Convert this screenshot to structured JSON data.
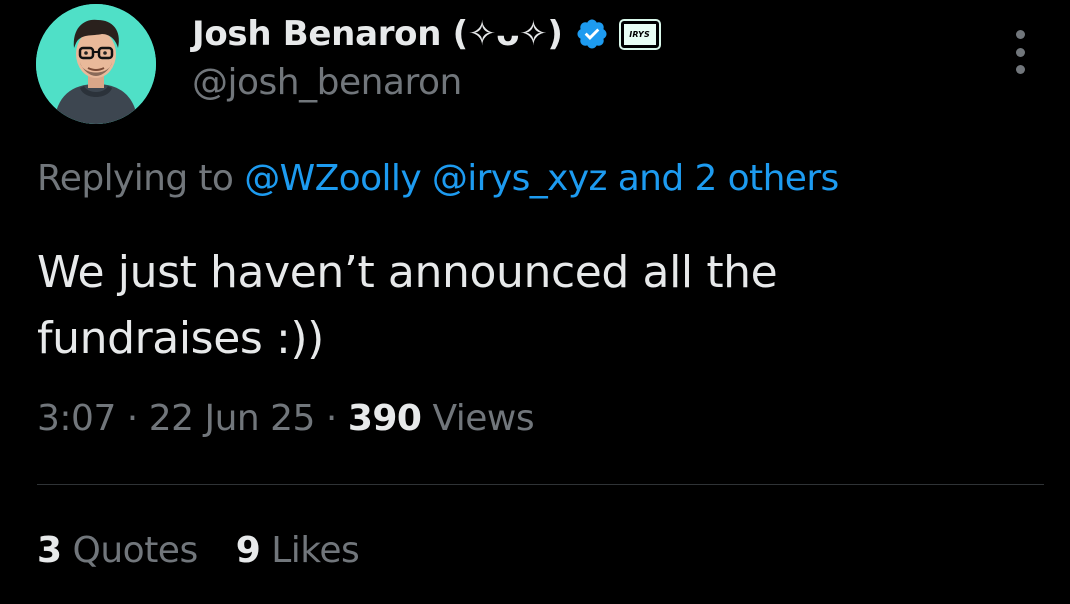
{
  "author": {
    "display_name": "Josh Benaron (✧ᴗ✧)",
    "handle": "@josh_benaron",
    "affiliate_badge_text": "IRYS",
    "verified_color": "#1d9bf0",
    "avatar_icon": "cartoon-avatar-with-glasses"
  },
  "reply": {
    "prefix": "Replying to ",
    "mention_1": "@WZoolly",
    "mention_2": "@irys_xyz",
    "others": "and 2 others"
  },
  "tweet": {
    "line_1": "We just haven’t announced all the",
    "line_2": "fundraises :))"
  },
  "meta": {
    "time": "3:07",
    "date": "22 Jun 25",
    "views_count": "390",
    "views_label": "Views",
    "separator": "·"
  },
  "stats": {
    "quotes_count": "3",
    "quotes_label": "Quotes",
    "likes_count": "9",
    "likes_label": "Likes"
  },
  "colors": {
    "background": "#000000",
    "text_primary": "#e7e9ea",
    "text_secondary": "#71767b",
    "link": "#1d9bf0",
    "avatar_bg": "#4fe0c7"
  }
}
